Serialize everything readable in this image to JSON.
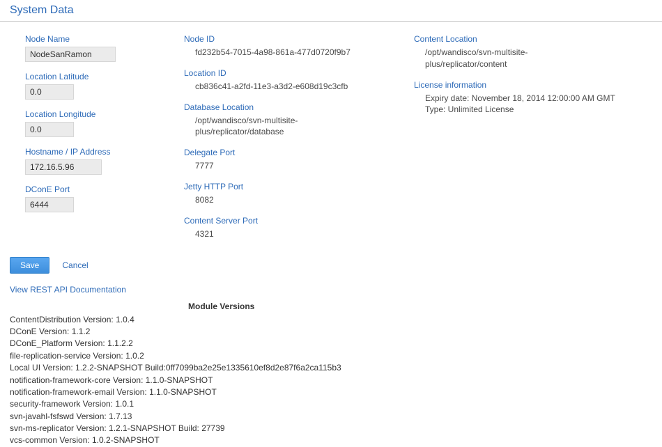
{
  "title": "System Data",
  "col1": {
    "node_name": {
      "label": "Node Name",
      "value": "NodeSanRamon"
    },
    "latitude": {
      "label": "Location Latitude",
      "value": "0.0"
    },
    "longitude": {
      "label": "Location Longitude",
      "value": "0.0"
    },
    "hostname": {
      "label": "Hostname / IP Address",
      "value": "172.16.5.96"
    },
    "dcone_port": {
      "label": "DConE Port",
      "value": "6444"
    }
  },
  "col2": {
    "node_id": {
      "label": "Node ID",
      "value": "fd232b54-7015-4a98-861a-477d0720f9b7"
    },
    "location_id": {
      "label": "Location ID",
      "value": "cb836c41-a2fd-11e3-a3d2-e608d19c3cfb"
    },
    "db_location": {
      "label": "Database Location",
      "value": "/opt/wandisco/svn-multisite-plus/replicator/database"
    },
    "delegate_port": {
      "label": "Delegate Port",
      "value": "7777"
    },
    "jetty_port": {
      "label": "Jetty HTTP Port",
      "value": "8082"
    },
    "content_port": {
      "label": "Content Server Port",
      "value": "4321"
    }
  },
  "col3": {
    "content_loc": {
      "label": "Content Location",
      "value": "/opt/wandisco/svn-multisite-plus/replicator/content"
    },
    "license": {
      "label": "License information",
      "expiry": "Expiry date: November 18, 2014 12:00:00 AM GMT",
      "type": "Type: Unlimited License"
    }
  },
  "actions": {
    "save": "Save",
    "cancel": "Cancel",
    "rest": "View REST API Documentation"
  },
  "modules": {
    "header": "Module Versions",
    "lines": [
      "ContentDistribution Version: 1.0.4",
      "DConE Version: 1.1.2",
      "DConE_Platform Version: 1.1.2.2",
      "file-replication-service Version: 1.0.2",
      "Local UI Version: 1.2.2-SNAPSHOT Build:0ff7099ba2e25e1335610ef8d2e87f6a2ca115b3",
      "notification-framework-core Version: 1.1.0-SNAPSHOT",
      "notification-framework-email Version: 1.1.0-SNAPSHOT",
      "security-framework Version: 1.0.1",
      "svn-javahl-fsfswd Version: 1.7.13",
      "svn-ms-replicator Version: 1.2.1-SNAPSHOT Build: 27739",
      "vcs-common Version: 1.0.2-SNAPSHOT"
    ]
  }
}
